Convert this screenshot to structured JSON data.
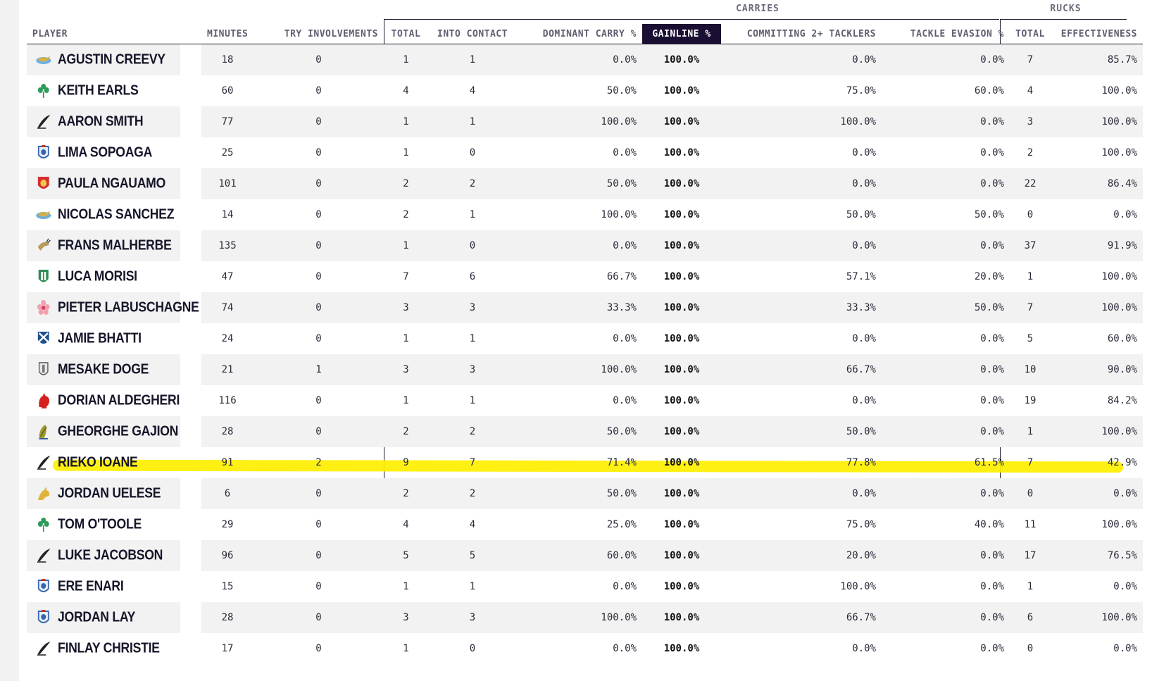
{
  "groups": {
    "carries": "CARRIES",
    "rucks": "RUCKS"
  },
  "columns": {
    "player": "PLAYER",
    "minutes": "MINUTES",
    "try_involvements": "TRY INVOLVEMENTS",
    "carries_total": "TOTAL",
    "into_contact": "INTO CONTACT",
    "dominant_carry": "DOMINANT CARRY %",
    "gainline": "GAINLINE %",
    "committing": "COMMITTING 2+ TACKLERS",
    "tackle_evasion": "TACKLE EVASION %",
    "rucks_total": "TOTAL",
    "effectiveness": "EFFECTIVENESS"
  },
  "rows": [
    {
      "team": "argentina-icon",
      "name": "AGUSTIN CREEVY",
      "minutes": "18",
      "try": "0",
      "total": "1",
      "contact": "1",
      "dominant": "0.0%",
      "gainline": "100.0%",
      "committing": "0.0%",
      "evasion": "0.0%",
      "rucks": "7",
      "eff": "85.7%"
    },
    {
      "team": "ireland-icon",
      "name": "KEITH EARLS",
      "minutes": "60",
      "try": "0",
      "total": "4",
      "contact": "4",
      "dominant": "50.0%",
      "gainline": "100.0%",
      "committing": "75.0%",
      "evasion": "60.0%",
      "rucks": "4",
      "eff": "100.0%"
    },
    {
      "team": "new-zealand-icon",
      "name": "AARON SMITH",
      "minutes": "77",
      "try": "0",
      "total": "1",
      "contact": "1",
      "dominant": "100.0%",
      "gainline": "100.0%",
      "committing": "100.0%",
      "evasion": "0.0%",
      "rucks": "3",
      "eff": "100.0%"
    },
    {
      "team": "samoa-icon",
      "name": "LIMA SOPOAGA",
      "minutes": "25",
      "try": "0",
      "total": "1",
      "contact": "0",
      "dominant": "0.0%",
      "gainline": "100.0%",
      "committing": "0.0%",
      "evasion": "0.0%",
      "rucks": "2",
      "eff": "100.0%"
    },
    {
      "team": "tonga-icon",
      "name": "PAULA NGAUAMO",
      "minutes": "101",
      "try": "0",
      "total": "2",
      "contact": "2",
      "dominant": "50.0%",
      "gainline": "100.0%",
      "committing": "0.0%",
      "evasion": "0.0%",
      "rucks": "22",
      "eff": "86.4%"
    },
    {
      "team": "argentina-icon",
      "name": "NICOLAS SANCHEZ",
      "minutes": "14",
      "try": "0",
      "total": "2",
      "contact": "1",
      "dominant": "100.0%",
      "gainline": "100.0%",
      "committing": "50.0%",
      "evasion": "50.0%",
      "rucks": "0",
      "eff": "0.0%"
    },
    {
      "team": "south-africa-icon",
      "name": "FRANS MALHERBE",
      "minutes": "135",
      "try": "0",
      "total": "1",
      "contact": "0",
      "dominant": "0.0%",
      "gainline": "100.0%",
      "committing": "0.0%",
      "evasion": "0.0%",
      "rucks": "37",
      "eff": "91.9%"
    },
    {
      "team": "italy-icon",
      "name": "LUCA MORISI",
      "minutes": "47",
      "try": "0",
      "total": "7",
      "contact": "6",
      "dominant": "66.7%",
      "gainline": "100.0%",
      "committing": "57.1%",
      "evasion": "20.0%",
      "rucks": "1",
      "eff": "100.0%"
    },
    {
      "team": "japan-icon",
      "name": "PIETER LABUSCHAGNE",
      "minutes": "74",
      "try": "0",
      "total": "3",
      "contact": "3",
      "dominant": "33.3%",
      "gainline": "100.0%",
      "committing": "33.3%",
      "evasion": "50.0%",
      "rucks": "7",
      "eff": "100.0%"
    },
    {
      "team": "scotland-icon",
      "name": "JAMIE BHATTI",
      "minutes": "24",
      "try": "0",
      "total": "1",
      "contact": "1",
      "dominant": "0.0%",
      "gainline": "100.0%",
      "committing": "0.0%",
      "evasion": "0.0%",
      "rucks": "5",
      "eff": "60.0%"
    },
    {
      "team": "fiji-icon",
      "name": "MESAKE DOGE",
      "minutes": "21",
      "try": "1",
      "total": "3",
      "contact": "3",
      "dominant": "100.0%",
      "gainline": "100.0%",
      "committing": "66.7%",
      "evasion": "0.0%",
      "rucks": "10",
      "eff": "90.0%"
    },
    {
      "team": "france-icon",
      "name": "DORIAN ALDEGHERI",
      "minutes": "116",
      "try": "0",
      "total": "1",
      "contact": "1",
      "dominant": "0.0%",
      "gainline": "100.0%",
      "committing": "0.0%",
      "evasion": "0.0%",
      "rucks": "19",
      "eff": "84.2%"
    },
    {
      "team": "romania-icon",
      "name": "GHEORGHE GAJION",
      "minutes": "28",
      "try": "0",
      "total": "2",
      "contact": "2",
      "dominant": "50.0%",
      "gainline": "100.0%",
      "committing": "50.0%",
      "evasion": "0.0%",
      "rucks": "1",
      "eff": "100.0%"
    },
    {
      "team": "new-zealand-icon",
      "name": "RIEKO IOANE",
      "minutes": "91",
      "try": "2",
      "total": "9",
      "contact": "7",
      "dominant": "71.4%",
      "gainline": "100.0%",
      "committing": "77.8%",
      "evasion": "61.5%",
      "rucks": "7",
      "eff": "42.9%"
    },
    {
      "team": "australia-icon",
      "name": "JORDAN UELESE",
      "minutes": "6",
      "try": "0",
      "total": "2",
      "contact": "2",
      "dominant": "50.0%",
      "gainline": "100.0%",
      "committing": "0.0%",
      "evasion": "0.0%",
      "rucks": "0",
      "eff": "0.0%"
    },
    {
      "team": "ireland-icon",
      "name": "TOM O'TOOLE",
      "minutes": "29",
      "try": "0",
      "total": "4",
      "contact": "4",
      "dominant": "25.0%",
      "gainline": "100.0%",
      "committing": "75.0%",
      "evasion": "40.0%",
      "rucks": "11",
      "eff": "100.0%"
    },
    {
      "team": "new-zealand-icon",
      "name": "LUKE JACOBSON",
      "minutes": "96",
      "try": "0",
      "total": "5",
      "contact": "5",
      "dominant": "60.0%",
      "gainline": "100.0%",
      "committing": "20.0%",
      "evasion": "0.0%",
      "rucks": "17",
      "eff": "76.5%"
    },
    {
      "team": "samoa-icon",
      "name": "ERE ENARI",
      "minutes": "15",
      "try": "0",
      "total": "1",
      "contact": "1",
      "dominant": "0.0%",
      "gainline": "100.0%",
      "committing": "100.0%",
      "evasion": "0.0%",
      "rucks": "1",
      "eff": "0.0%"
    },
    {
      "team": "samoa-icon",
      "name": "JORDAN LAY",
      "minutes": "28",
      "try": "0",
      "total": "3",
      "contact": "3",
      "dominant": "100.0%",
      "gainline": "100.0%",
      "committing": "66.7%",
      "evasion": "0.0%",
      "rucks": "6",
      "eff": "100.0%"
    },
    {
      "team": "new-zealand-icon",
      "name": "FINLAY CHRISTIE",
      "minutes": "17",
      "try": "0",
      "total": "1",
      "contact": "0",
      "dominant": "0.0%",
      "gainline": "100.0%",
      "committing": "0.0%",
      "evasion": "0.0%",
      "rucks": "0",
      "eff": "0.0%"
    }
  ],
  "highlighted_player": "RIEKO IOANE",
  "colors": {
    "header_active": "#1a0f33",
    "highlight": "#ffef00",
    "stripe": "#f2f2f2"
  }
}
